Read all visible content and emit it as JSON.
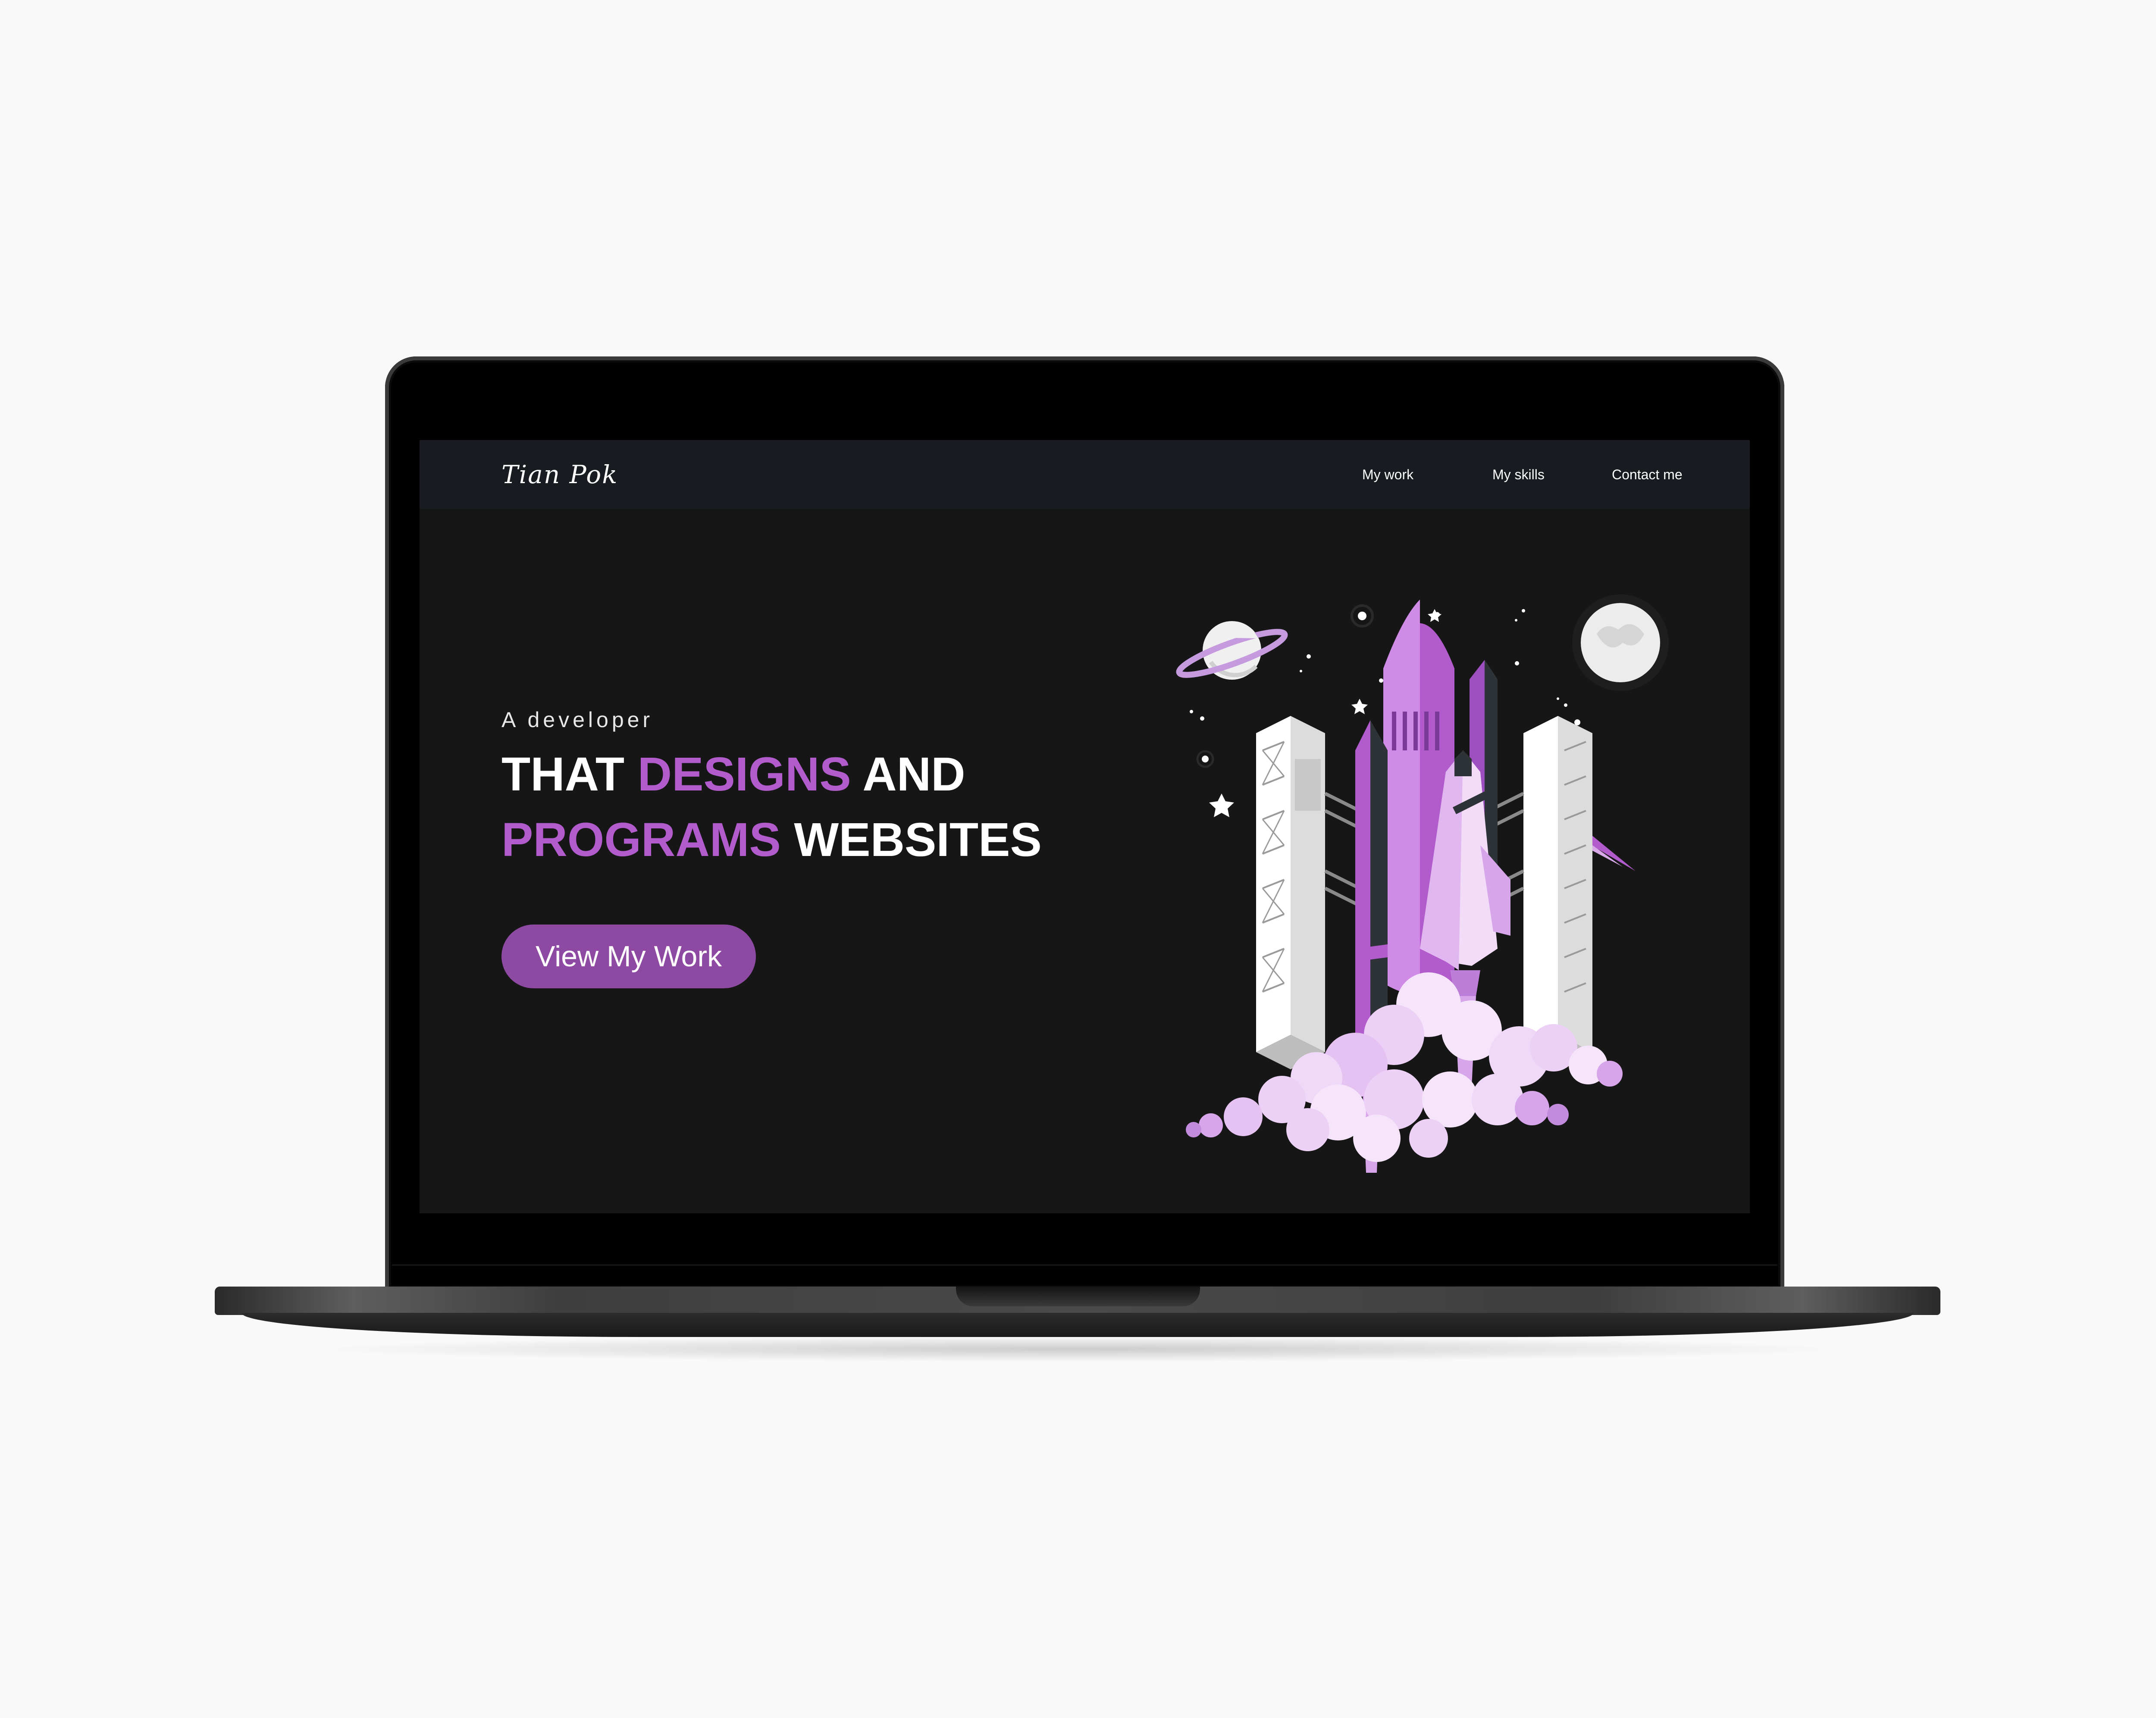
{
  "colors": {
    "page_background": "#f9f9f9",
    "screen_background": "#161616",
    "navbar_background": "#181c21",
    "accent": "#b15bcc",
    "button": "#8e4aa3",
    "text": "#ffffff"
  },
  "navbar": {
    "logo": "Tian Pok",
    "links": [
      {
        "label": "My work"
      },
      {
        "label": "My skills"
      },
      {
        "label": "Contact me"
      }
    ]
  },
  "hero": {
    "subtitle": "A developer",
    "title": {
      "part1": "THAT ",
      "accent1": "DESIGNS",
      "part2": " AND",
      "accent2": "PROGRAMS",
      "part3": " WEBSITES"
    },
    "cta_label": "View My Work"
  },
  "illustration": {
    "icons": [
      "rocket-icon",
      "launch-tower-icon",
      "planet-icon",
      "moon-icon",
      "star-icon",
      "shooting-star-icon",
      "smoke-cloud-icon"
    ]
  }
}
